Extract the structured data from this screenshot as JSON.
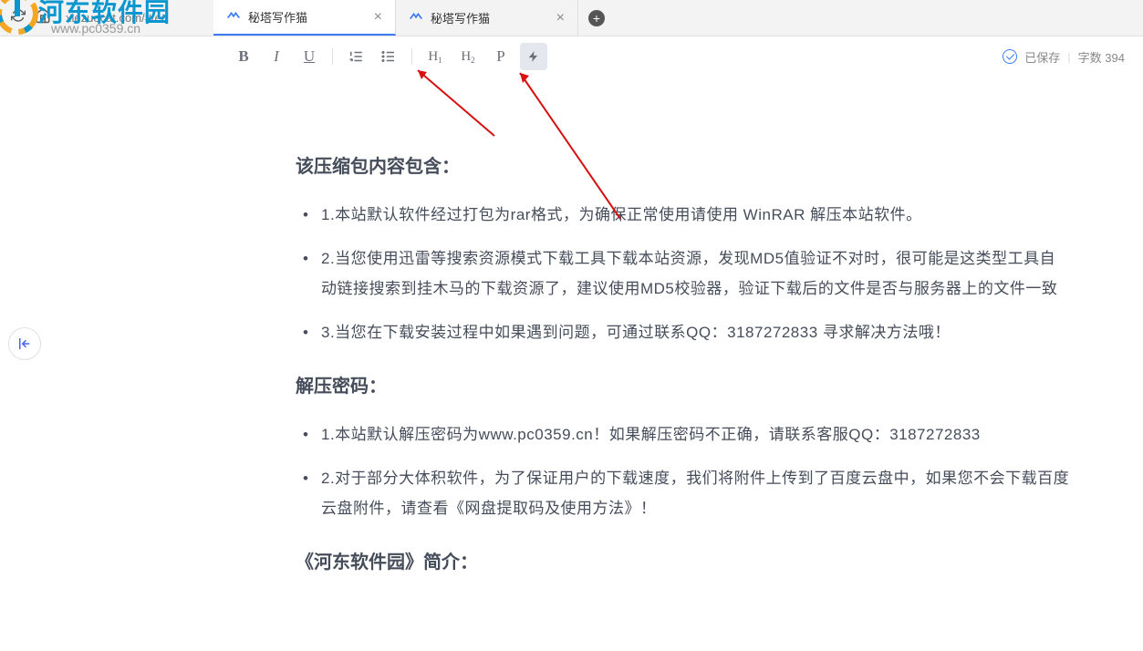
{
  "browser": {
    "url": "xiezuocat.com/#/ed",
    "tabs": [
      {
        "title": "秘塔写作猫",
        "active": true
      },
      {
        "title": "秘塔写作猫",
        "active": false
      }
    ]
  },
  "toolbar": {
    "bold": "B",
    "italic": "I",
    "underline": "U",
    "ol_icon": "ol",
    "ul_icon": "ul",
    "h1": "H",
    "h1_sub": "1",
    "h2": "H",
    "h2_sub": "2",
    "p": "P",
    "flash": "⚡"
  },
  "status": {
    "saved": "已保存",
    "wordcount_label": "字数",
    "wordcount": "394"
  },
  "document": {
    "heading1": "该压缩包内容包含：",
    "list1": [
      "1.本站默认软件经过打包为rar格式，为确保正常使用请使用 WinRAR 解压本站软件。",
      "2.当您使用迅雷等搜索资源模式下载工具下载本站资源，发现MD5值验证不对时，很可能是这类型工具自动链接搜索到挂木马的下载资源了，建议使用MD5校验器，验证下载后的文件是否与服务器上的文件一致",
      "3.当您在下载安装过程中如果遇到问题，可通过联系QQ：3187272833 寻求解决方法哦！"
    ],
    "heading2": "解压密码：",
    "list2": [
      "1.本站默认解压密码为www.pc0359.cn！如果解压密码不正确，请联系客服QQ：3187272833",
      "2.对于部分大体积软件，为了保证用户的下载速度，我们将附件上传到了百度云盘中，如果您不会下载百度云盘附件，请查看《网盘提取码及使用方法》！"
    ],
    "heading3": "《河东软件园》简介："
  },
  "watermark": {
    "text": "河东软件园",
    "url": "www.pc0359.cn"
  }
}
